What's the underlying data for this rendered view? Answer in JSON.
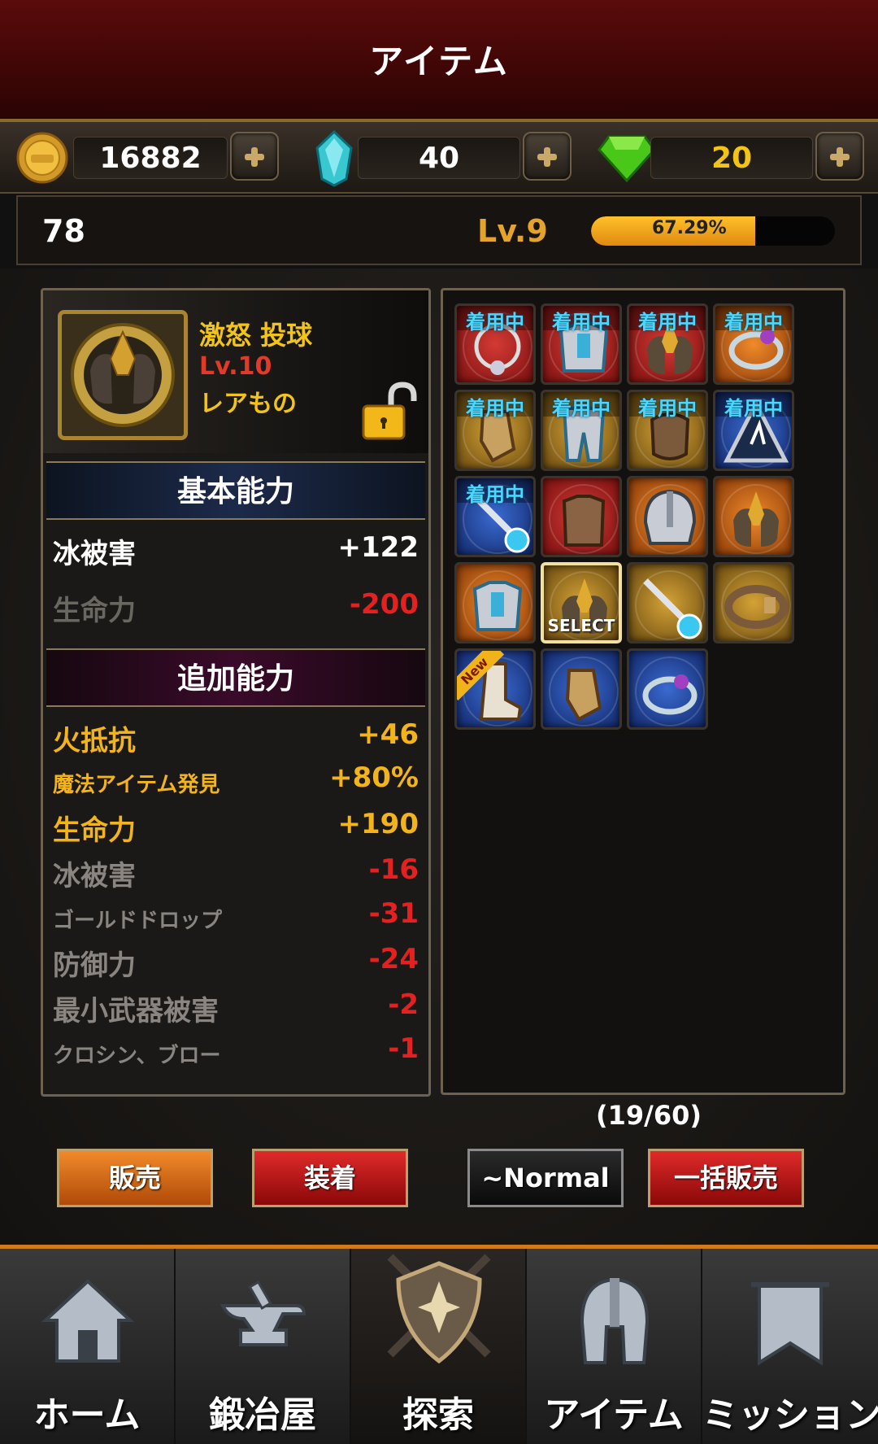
{
  "header": {
    "title": "アイテム"
  },
  "currency": {
    "gold": "16882",
    "crystal": "40",
    "gem": "20",
    "gem_color": "#f2c418"
  },
  "level": {
    "left_value": "78",
    "label": "Lv.9",
    "xp_percent_text": "67.29%",
    "xp_fraction": 0.6729
  },
  "detail": {
    "name": "激怒 投球",
    "level": "Lv.10",
    "rarity": "レアもの",
    "basic_title": "基本能力",
    "basic_stats": [
      {
        "label": "冰被害",
        "value": "+122"
      },
      {
        "label": "生命力",
        "value": "-200"
      }
    ],
    "extra_title": "追加能力",
    "extra_stats": [
      {
        "label": "火抵抗",
        "value": "+46"
      },
      {
        "label": "魔法アイテム発見",
        "value": "+80%"
      },
      {
        "label": "生命力",
        "value": "+190"
      },
      {
        "label": "冰被害",
        "value": "-16"
      },
      {
        "label": "ゴールドドロップ",
        "value": "-31"
      },
      {
        "label": "防御力",
        "value": "-24"
      },
      {
        "label": "最小武器被害",
        "value": "-2"
      },
      {
        "label": "クロシン、ブロー",
        "value": "-1"
      }
    ]
  },
  "inventory": {
    "equipped_label": "着用中",
    "select_label": "SELECT",
    "new_label": "New",
    "count": "(19/60)",
    "slots": [
      {
        "color": "red",
        "equipped": true,
        "icon": "amulet-icon"
      },
      {
        "color": "red",
        "equipped": true,
        "icon": "chest-armor-icon"
      },
      {
        "color": "red",
        "equipped": true,
        "icon": "shoulder-armor-icon"
      },
      {
        "color": "orange",
        "equipped": true,
        "icon": "ring-icon"
      },
      {
        "color": "gold",
        "equipped": true,
        "icon": "gauntlet-icon"
      },
      {
        "color": "gold",
        "equipped": true,
        "icon": "leg-armor-icon"
      },
      {
        "color": "gold",
        "equipped": true,
        "icon": "belt-pouch-icon"
      },
      {
        "color": "blue",
        "equipped": true,
        "icon": "rune-stone-icon"
      },
      {
        "color": "blue",
        "equipped": true,
        "icon": "sword-icon"
      },
      {
        "color": "red",
        "equipped": false,
        "icon": "leather-armor-icon"
      },
      {
        "color": "orange",
        "equipped": false,
        "icon": "helmet-icon"
      },
      {
        "color": "orange",
        "equipped": false,
        "icon": "shoulder-armor-icon"
      },
      {
        "color": "orange",
        "equipped": false,
        "icon": "chest-armor-icon"
      },
      {
        "color": "gold",
        "equipped": false,
        "icon": "shoulder-armor-icon",
        "selected": true
      },
      {
        "color": "gold",
        "equipped": false,
        "icon": "sword-icon"
      },
      {
        "color": "gold",
        "equipped": false,
        "icon": "belt-icon"
      },
      {
        "color": "blue",
        "equipped": false,
        "icon": "boots-icon",
        "new": true
      },
      {
        "color": "blue",
        "equipped": false,
        "icon": "gauntlet-icon"
      },
      {
        "color": "blue",
        "equipped": false,
        "icon": "ring-icon"
      }
    ]
  },
  "actions": {
    "sell": "販売",
    "equip": "装着",
    "filter": "~Normal",
    "bulk_sell": "一括販売"
  },
  "nav": {
    "home": "ホーム",
    "forge": "鍛冶屋",
    "explore": "探索",
    "item": "アイテム",
    "mission": "ミッション"
  },
  "colors": {
    "accent_gold": "#f2c418",
    "stat_negative": "#e42020",
    "stat_dim": "#8a8580",
    "stat_yellow": "#f2b41a",
    "stat_white": "#ffffff"
  }
}
